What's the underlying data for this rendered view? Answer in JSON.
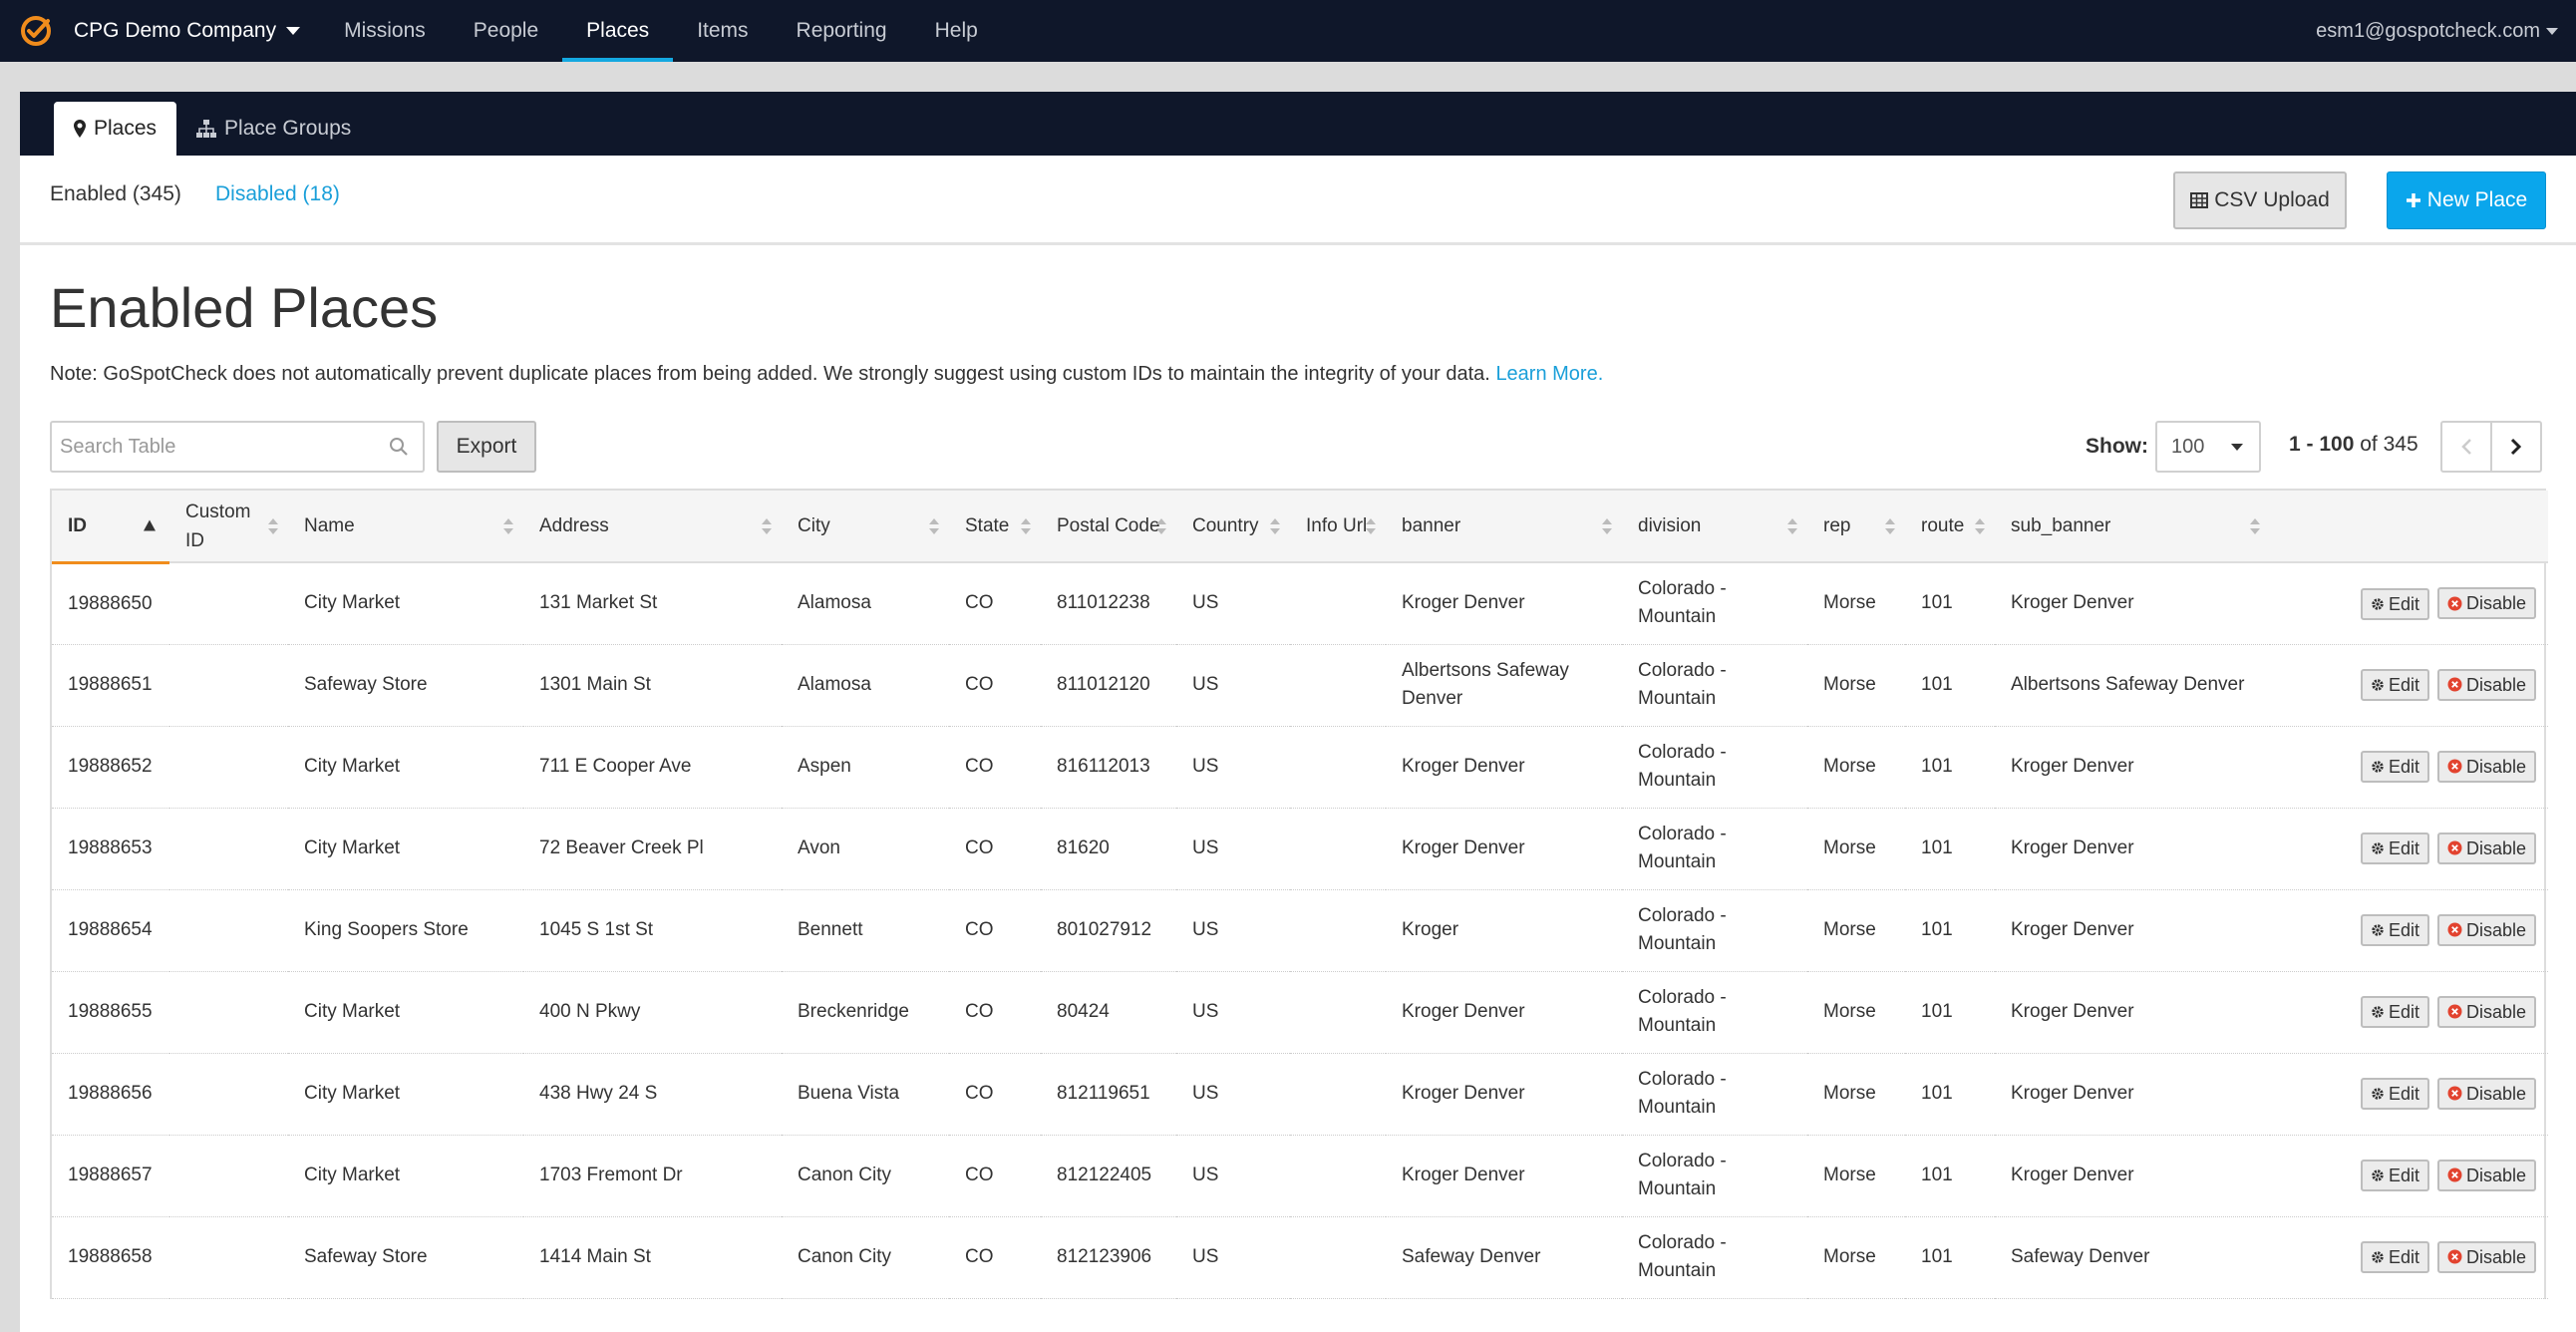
{
  "topnav": {
    "company": "CPG Demo Company",
    "links": [
      "Missions",
      "People",
      "Places",
      "Items",
      "Reporting",
      "Help"
    ],
    "active": "Places",
    "user": "esm1@gospotcheck.com"
  },
  "subtabs": {
    "places": "Places",
    "place_groups": "Place Groups"
  },
  "filters": {
    "enabled": "Enabled (345)",
    "disabled": "Disabled (18)"
  },
  "buttons": {
    "csv_upload": "CSV Upload",
    "new_place": "New Place",
    "export": "Export",
    "edit": "Edit",
    "disable": "Disable"
  },
  "page": {
    "title": "Enabled Places",
    "note": "Note: GoSpotCheck does not automatically prevent duplicate places from being added. We strongly suggest using custom IDs to maintain the integrity of your data.",
    "learn_more": "Learn More."
  },
  "search": {
    "placeholder": "Search Table"
  },
  "pagination": {
    "show_label": "Show:",
    "show_value": "100",
    "range": "1 - 100",
    "of_total": "of 345"
  },
  "colors": {
    "accent": "#14a8e0",
    "nav_bg": "#0f172a",
    "sort_indicator": "#f08c1c",
    "primary_button": "#0aa6ec"
  },
  "table": {
    "columns": [
      "ID",
      "Custom ID",
      "Name",
      "Address",
      "City",
      "State",
      "Postal Code",
      "Country",
      "Info Url",
      "banner",
      "division",
      "rep",
      "route",
      "sub_banner"
    ],
    "rows": [
      [
        "19888650",
        "",
        "City Market",
        "131 Market St",
        "Alamosa",
        "CO",
        "811012238",
        "US",
        "",
        "Kroger Denver",
        "Colorado - Mountain",
        "Morse",
        "101",
        "Kroger Denver"
      ],
      [
        "19888651",
        "",
        "Safeway Store",
        "1301 Main St",
        "Alamosa",
        "CO",
        "811012120",
        "US",
        "",
        "Albertsons Safeway Denver",
        "Colorado - Mountain",
        "Morse",
        "101",
        "Albertsons Safeway Denver"
      ],
      [
        "19888652",
        "",
        "City Market",
        "711 E Cooper Ave",
        "Aspen",
        "CO",
        "816112013",
        "US",
        "",
        "Kroger Denver",
        "Colorado - Mountain",
        "Morse",
        "101",
        "Kroger Denver"
      ],
      [
        "19888653",
        "",
        "City Market",
        "72 Beaver Creek Pl",
        "Avon",
        "CO",
        "81620",
        "US",
        "",
        "Kroger Denver",
        "Colorado - Mountain",
        "Morse",
        "101",
        "Kroger Denver"
      ],
      [
        "19888654",
        "",
        "King Soopers Store",
        "1045 S 1st St",
        "Bennett",
        "CO",
        "801027912",
        "US",
        "",
        "Kroger",
        "Colorado - Mountain",
        "Morse",
        "101",
        "Kroger Denver"
      ],
      [
        "19888655",
        "",
        "City Market",
        "400 N Pkwy",
        "Breckenridge",
        "CO",
        "80424",
        "US",
        "",
        "Kroger Denver",
        "Colorado - Mountain",
        "Morse",
        "101",
        "Kroger Denver"
      ],
      [
        "19888656",
        "",
        "City Market",
        "438 Hwy 24 S",
        "Buena Vista",
        "CO",
        "812119651",
        "US",
        "",
        "Kroger Denver",
        "Colorado - Mountain",
        "Morse",
        "101",
        "Kroger Denver"
      ],
      [
        "19888657",
        "",
        "City Market",
        "1703 Fremont Dr",
        "Canon City",
        "CO",
        "812122405",
        "US",
        "",
        "Kroger Denver",
        "Colorado - Mountain",
        "Morse",
        "101",
        "Kroger Denver"
      ],
      [
        "19888658",
        "",
        "Safeway Store",
        "1414 Main St",
        "Canon City",
        "CO",
        "812123906",
        "US",
        "",
        "Safeway Denver",
        "Colorado - Mountain",
        "Morse",
        "101",
        "Safeway Denver"
      ]
    ]
  }
}
